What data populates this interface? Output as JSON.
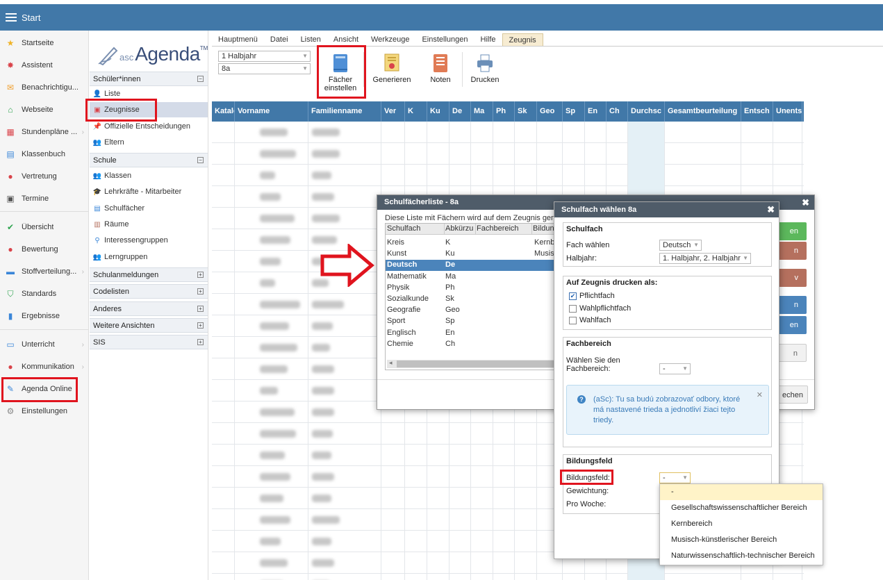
{
  "topbar": {
    "title": "Start"
  },
  "leftnav": [
    {
      "label": "Startseite",
      "icon": "star-icon",
      "color": "#f0b429"
    },
    {
      "label": "Assistent",
      "icon": "wand-icon",
      "color": "#d9434a"
    },
    {
      "label": "Benachrichtigu...",
      "icon": "envelope-icon",
      "color": "#f0a030"
    },
    {
      "label": "Webseite",
      "icon": "home-icon",
      "color": "#2ea44f"
    },
    {
      "label": "Stundenpläne ...",
      "icon": "timetable-icon",
      "color": "#d9434a"
    },
    {
      "label": "Klassenbuch",
      "icon": "book-icon",
      "color": "#3a86d8"
    },
    {
      "label": "Vertretung",
      "icon": "substitute-icon",
      "color": "#d9434a"
    },
    {
      "label": "Termine",
      "icon": "calendar-icon",
      "color": "#555555"
    },
    {
      "label": "Übersicht",
      "icon": "check-circle-icon",
      "color": "#2ea44f"
    },
    {
      "label": "Bewertung",
      "icon": "grade-icon",
      "color": "#d9434a"
    },
    {
      "label": "Stoffverteilung...",
      "icon": "briefcase-icon",
      "color": "#3a86d8"
    },
    {
      "label": "Standards",
      "icon": "shield-icon",
      "color": "#2ea44f"
    },
    {
      "label": "Ergebnisse",
      "icon": "bar-chart-icon",
      "color": "#3a86d8"
    },
    {
      "label": "Unterricht",
      "icon": "open-book-icon",
      "color": "#3a86d8"
    },
    {
      "label": "Kommunikation",
      "icon": "chat-icon",
      "color": "#d9434a"
    },
    {
      "label": "Agenda Online",
      "icon": "pen-icon",
      "color": "#3a86d8"
    },
    {
      "label": "Einstellungen",
      "icon": "gear-icon",
      "color": "#888888"
    }
  ],
  "logo": {
    "asc": "asc",
    "agenda": "Agenda",
    "tm": "TM"
  },
  "panel": {
    "sec_schueler": "Schüler*innen",
    "items_schueler": [
      "Liste",
      "Zeugnisse",
      "Offizielle Entscheidungen",
      "Eltern"
    ],
    "sec_schule": "Schule",
    "items_schule": [
      "Klassen",
      "Lehrkräfte - Mitarbeiter",
      "Schulfächer",
      "Räume",
      "Interessengruppen",
      "Lerngruppen"
    ],
    "sec_more": [
      "Schulanmeldungen",
      "Codelisten",
      "Anderes",
      "Weitere Ansichten",
      "SIS"
    ]
  },
  "menu": [
    "Hauptmenü",
    "Datei",
    "Listen",
    "Ansicht",
    "Werkzeuge",
    "Einstellungen",
    "Hilfe",
    "Zeugnis"
  ],
  "ribbon": {
    "period": "1 Halbjahr",
    "class": "8a",
    "btn_faecher": "Fächer einstellen",
    "btn_generieren": "Generieren",
    "btn_noten": "Noten",
    "btn_drucken": "Drucken"
  },
  "grid": {
    "headers": [
      "Katalo",
      "Vorname",
      "Familienname",
      "Ver",
      "K",
      "Ku",
      "De",
      "Ma",
      "Ph",
      "Sk",
      "Geo",
      "Sp",
      "En",
      "Ch",
      "Durchsc",
      "Gesamtbeurteilung",
      "Entsch",
      "Unents"
    ]
  },
  "dlg1": {
    "title": "Schulfächerliste - 8a",
    "desc": "Diese Liste mit Fächern wird auf dem Zeugnis gena",
    "cols": [
      "Schulfach",
      "Abkürzu",
      "Fachbereich",
      "Bildun"
    ],
    "rows": [
      {
        "name": "Kreis",
        "abbr": "K",
        "bild": "Kernb"
      },
      {
        "name": "Kunst",
        "abbr": "Ku",
        "bild": "Musis"
      },
      {
        "name": "Deutsch",
        "abbr": "De",
        "bild": ""
      },
      {
        "name": "Mathematik",
        "abbr": "Ma",
        "bild": ""
      },
      {
        "name": "Physik",
        "abbr": "Ph",
        "bild": ""
      },
      {
        "name": "Sozialkunde",
        "abbr": "Sk",
        "bild": ""
      },
      {
        "name": "Geografie",
        "abbr": "Geo",
        "bild": ""
      },
      {
        "name": "Sport",
        "abbr": "Sp",
        "bild": ""
      },
      {
        "name": "Englisch",
        "abbr": "En",
        "bild": ""
      },
      {
        "name": "Chemie",
        "abbr": "Ch",
        "bild": ""
      }
    ],
    "btn_frag_1": "en",
    "btn_frag_2": "n",
    "btn_frag_3": "v",
    "btn_frag_4": "n",
    "btn_frag_5": "en",
    "btn_frag_6": "n",
    "btn_close_frag": "echen"
  },
  "dlg2": {
    "title": "Schulfach wählen 8a",
    "sec_schulfach": "Schulfach",
    "lbl_fach": "Fach wählen",
    "val_fach": "Deutsch",
    "lbl_halbjahr": "Halbjahr:",
    "val_halbjahr": "1. Halbjahr, 2. Halbjahr",
    "sec_druck": "Auf Zeugnis drucken als:",
    "opt_pflicht": "Pflichtfach",
    "opt_wahlpflicht": "Wahlpflichtfach",
    "opt_wahl": "Wahlfach",
    "sec_fachbereich": "Fachbereich",
    "lbl_fachbereich_1": "Wählen Sie den",
    "lbl_fachbereich_2": "Fachbereich:",
    "val_fachbereich": "-",
    "info": "(aSc): Tu sa budú zobrazovať odbory, ktoré má nastavené trieda a jednotliví žiaci tejto triedy.",
    "sec_bildung": "Bildungsfeld",
    "lbl_bildung": "Bildungsfeld:",
    "val_bildung": "-",
    "lbl_gewichtung": "Gewichtung:",
    "lbl_pro_woche": "Pro Woche:"
  },
  "dropdown": [
    "-",
    "Gesellschaftswissenschaftlicher Bereich",
    "Kernbereich",
    "Musisch-künstlerischer Bereich",
    "Naturwissenschaftlich-technischer Bereich"
  ]
}
